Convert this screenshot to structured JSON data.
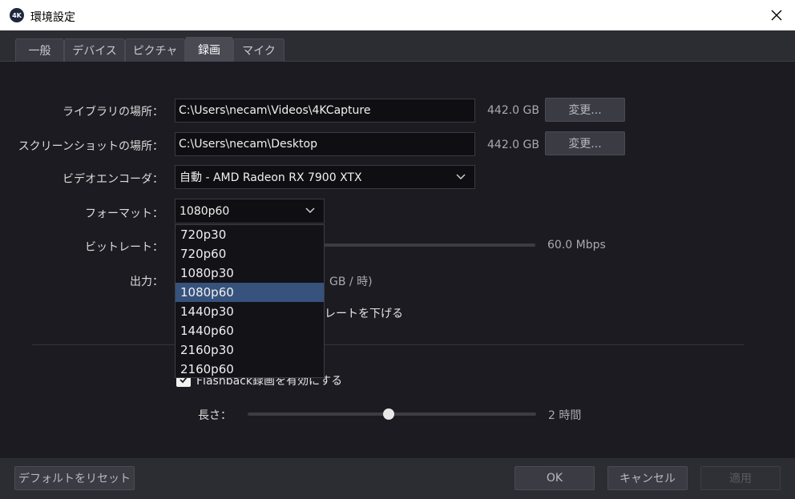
{
  "window": {
    "title": "環境設定",
    "logo_text": "4K"
  },
  "tabs": [
    {
      "label": "一般",
      "active": false
    },
    {
      "label": "デバイス",
      "active": false
    },
    {
      "label": "ピクチャ",
      "active": false
    },
    {
      "label": "録画",
      "active": true
    },
    {
      "label": "マイク",
      "active": false
    }
  ],
  "library": {
    "label": "ライブラリの場所：",
    "path": "C:\\Users\\necam\\Videos\\4KCapture",
    "free_space": "442.0 GB",
    "change_label": "変更..."
  },
  "screenshot": {
    "label": "スクリーンショットの場所：",
    "path": "C:\\Users\\necam\\Desktop",
    "free_space": "442.0 GB",
    "change_label": "変更..."
  },
  "encoder": {
    "label": "ビデオエンコーダ：",
    "value": "自動 - AMD Radeon RX 7900 XTX"
  },
  "format": {
    "label": "フォーマット：",
    "value": "1080p60",
    "options": [
      "720p30",
      "720p60",
      "1080p30",
      "1080p60",
      "1440p30",
      "1440p60",
      "2160p30",
      "2160p60"
    ],
    "selected_index": 3
  },
  "bitrate": {
    "label": "ビットレート：",
    "value_text": "60.0 Mbps",
    "fraction": 0.1
  },
  "output": {
    "label": "出力：",
    "value_text_partial": "GB / 時)"
  },
  "reduce_bitrate": {
    "label_partial": "レートを下げる"
  },
  "flashback": {
    "label_partial": "Flashback録画を有効にする",
    "checked": true
  },
  "length": {
    "label": "長さ：",
    "value_text": "2 時間",
    "fraction": 0.49
  },
  "footer": {
    "reset_label": "デフォルトをリセット",
    "ok_label": "OK",
    "cancel_label": "キャンセル",
    "apply_label": "適用"
  }
}
